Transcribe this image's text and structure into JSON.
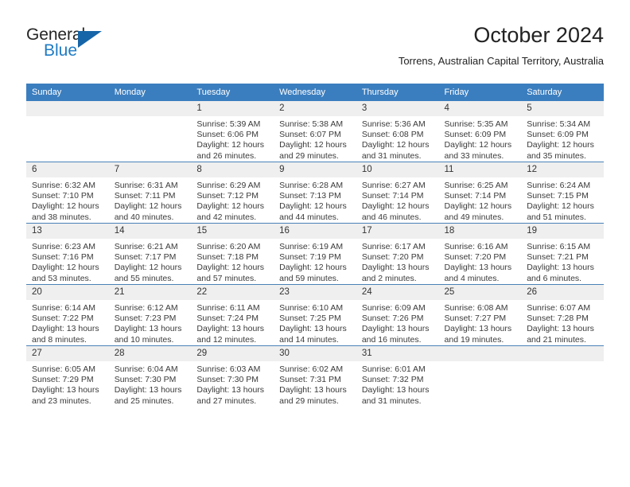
{
  "brand": {
    "name_part1": "General",
    "name_part2": "Blue",
    "accent_color": "#1e7bc4",
    "triangle_color": "#1565a8"
  },
  "header": {
    "title": "October 2024",
    "location": "Torrens, Australian Capital Territory, Australia",
    "header_bar_color": "#3b7ebf",
    "daynum_band_color": "#efefef"
  },
  "weekday_headers": [
    "Sunday",
    "Monday",
    "Tuesday",
    "Wednesday",
    "Thursday",
    "Friday",
    "Saturday"
  ],
  "weeks": [
    [
      {
        "day": "",
        "sunrise": "",
        "sunset": "",
        "daylight": "",
        "empty": true
      },
      {
        "day": "",
        "sunrise": "",
        "sunset": "",
        "daylight": "",
        "empty": true
      },
      {
        "day": "1",
        "sunrise": "Sunrise: 5:39 AM",
        "sunset": "Sunset: 6:06 PM",
        "daylight": "Daylight: 12 hours and 26 minutes."
      },
      {
        "day": "2",
        "sunrise": "Sunrise: 5:38 AM",
        "sunset": "Sunset: 6:07 PM",
        "daylight": "Daylight: 12 hours and 29 minutes."
      },
      {
        "day": "3",
        "sunrise": "Sunrise: 5:36 AM",
        "sunset": "Sunset: 6:08 PM",
        "daylight": "Daylight: 12 hours and 31 minutes."
      },
      {
        "day": "4",
        "sunrise": "Sunrise: 5:35 AM",
        "sunset": "Sunset: 6:09 PM",
        "daylight": "Daylight: 12 hours and 33 minutes."
      },
      {
        "day": "5",
        "sunrise": "Sunrise: 5:34 AM",
        "sunset": "Sunset: 6:09 PM",
        "daylight": "Daylight: 12 hours and 35 minutes."
      }
    ],
    [
      {
        "day": "6",
        "sunrise": "Sunrise: 6:32 AM",
        "sunset": "Sunset: 7:10 PM",
        "daylight": "Daylight: 12 hours and 38 minutes."
      },
      {
        "day": "7",
        "sunrise": "Sunrise: 6:31 AM",
        "sunset": "Sunset: 7:11 PM",
        "daylight": "Daylight: 12 hours and 40 minutes."
      },
      {
        "day": "8",
        "sunrise": "Sunrise: 6:29 AM",
        "sunset": "Sunset: 7:12 PM",
        "daylight": "Daylight: 12 hours and 42 minutes."
      },
      {
        "day": "9",
        "sunrise": "Sunrise: 6:28 AM",
        "sunset": "Sunset: 7:13 PM",
        "daylight": "Daylight: 12 hours and 44 minutes."
      },
      {
        "day": "10",
        "sunrise": "Sunrise: 6:27 AM",
        "sunset": "Sunset: 7:14 PM",
        "daylight": "Daylight: 12 hours and 46 minutes."
      },
      {
        "day": "11",
        "sunrise": "Sunrise: 6:25 AM",
        "sunset": "Sunset: 7:14 PM",
        "daylight": "Daylight: 12 hours and 49 minutes."
      },
      {
        "day": "12",
        "sunrise": "Sunrise: 6:24 AM",
        "sunset": "Sunset: 7:15 PM",
        "daylight": "Daylight: 12 hours and 51 minutes."
      }
    ],
    [
      {
        "day": "13",
        "sunrise": "Sunrise: 6:23 AM",
        "sunset": "Sunset: 7:16 PM",
        "daylight": "Daylight: 12 hours and 53 minutes."
      },
      {
        "day": "14",
        "sunrise": "Sunrise: 6:21 AM",
        "sunset": "Sunset: 7:17 PM",
        "daylight": "Daylight: 12 hours and 55 minutes."
      },
      {
        "day": "15",
        "sunrise": "Sunrise: 6:20 AM",
        "sunset": "Sunset: 7:18 PM",
        "daylight": "Daylight: 12 hours and 57 minutes."
      },
      {
        "day": "16",
        "sunrise": "Sunrise: 6:19 AM",
        "sunset": "Sunset: 7:19 PM",
        "daylight": "Daylight: 12 hours and 59 minutes."
      },
      {
        "day": "17",
        "sunrise": "Sunrise: 6:17 AM",
        "sunset": "Sunset: 7:20 PM",
        "daylight": "Daylight: 13 hours and 2 minutes."
      },
      {
        "day": "18",
        "sunrise": "Sunrise: 6:16 AM",
        "sunset": "Sunset: 7:20 PM",
        "daylight": "Daylight: 13 hours and 4 minutes."
      },
      {
        "day": "19",
        "sunrise": "Sunrise: 6:15 AM",
        "sunset": "Sunset: 7:21 PM",
        "daylight": "Daylight: 13 hours and 6 minutes."
      }
    ],
    [
      {
        "day": "20",
        "sunrise": "Sunrise: 6:14 AM",
        "sunset": "Sunset: 7:22 PM",
        "daylight": "Daylight: 13 hours and 8 minutes."
      },
      {
        "day": "21",
        "sunrise": "Sunrise: 6:12 AM",
        "sunset": "Sunset: 7:23 PM",
        "daylight": "Daylight: 13 hours and 10 minutes."
      },
      {
        "day": "22",
        "sunrise": "Sunrise: 6:11 AM",
        "sunset": "Sunset: 7:24 PM",
        "daylight": "Daylight: 13 hours and 12 minutes."
      },
      {
        "day": "23",
        "sunrise": "Sunrise: 6:10 AM",
        "sunset": "Sunset: 7:25 PM",
        "daylight": "Daylight: 13 hours and 14 minutes."
      },
      {
        "day": "24",
        "sunrise": "Sunrise: 6:09 AM",
        "sunset": "Sunset: 7:26 PM",
        "daylight": "Daylight: 13 hours and 16 minutes."
      },
      {
        "day": "25",
        "sunrise": "Sunrise: 6:08 AM",
        "sunset": "Sunset: 7:27 PM",
        "daylight": "Daylight: 13 hours and 19 minutes."
      },
      {
        "day": "26",
        "sunrise": "Sunrise: 6:07 AM",
        "sunset": "Sunset: 7:28 PM",
        "daylight": "Daylight: 13 hours and 21 minutes."
      }
    ],
    [
      {
        "day": "27",
        "sunrise": "Sunrise: 6:05 AM",
        "sunset": "Sunset: 7:29 PM",
        "daylight": "Daylight: 13 hours and 23 minutes."
      },
      {
        "day": "28",
        "sunrise": "Sunrise: 6:04 AM",
        "sunset": "Sunset: 7:30 PM",
        "daylight": "Daylight: 13 hours and 25 minutes."
      },
      {
        "day": "29",
        "sunrise": "Sunrise: 6:03 AM",
        "sunset": "Sunset: 7:30 PM",
        "daylight": "Daylight: 13 hours and 27 minutes."
      },
      {
        "day": "30",
        "sunrise": "Sunrise: 6:02 AM",
        "sunset": "Sunset: 7:31 PM",
        "daylight": "Daylight: 13 hours and 29 minutes."
      },
      {
        "day": "31",
        "sunrise": "Sunrise: 6:01 AM",
        "sunset": "Sunset: 7:32 PM",
        "daylight": "Daylight: 13 hours and 31 minutes."
      },
      {
        "day": "",
        "sunrise": "",
        "sunset": "",
        "daylight": "",
        "empty": true
      },
      {
        "day": "",
        "sunrise": "",
        "sunset": "",
        "daylight": "",
        "empty": true
      }
    ]
  ]
}
